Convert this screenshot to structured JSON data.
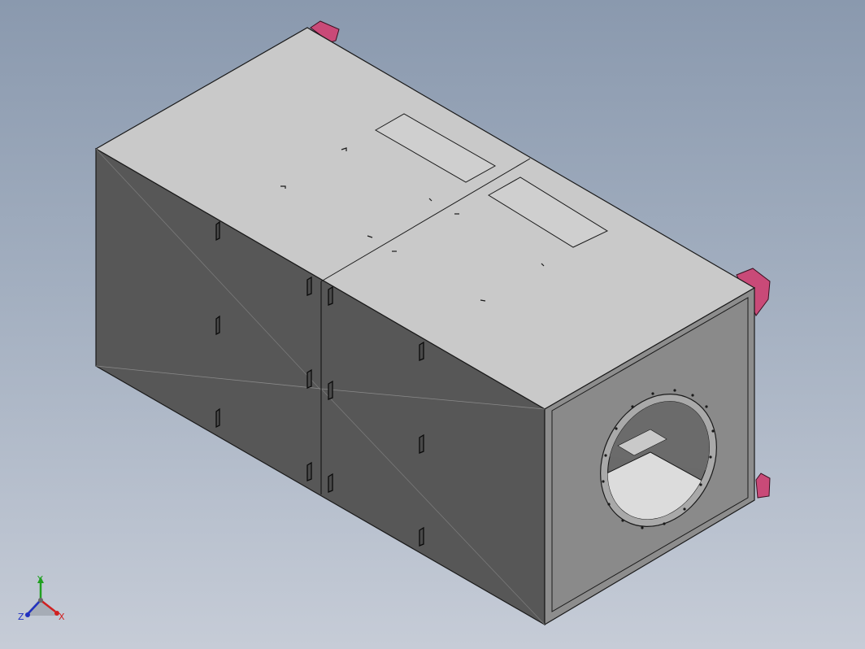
{
  "viewport": {
    "background_top": "#8a99ae",
    "background_bottom": "#c6ccd7"
  },
  "model": {
    "top_face_color": "#c8c8c8",
    "side_face_color": "#575757",
    "end_face_color": "#8e8e8e",
    "inner_face_color": "#b5b5b5",
    "foot_color": "#c94a78",
    "edge_color": "#1a1a1a"
  },
  "triad": {
    "x_label": "X",
    "y_label": "Y",
    "z_label": "Z",
    "x_color": "#d02020",
    "y_color": "#20a020",
    "z_color": "#2030c0"
  }
}
